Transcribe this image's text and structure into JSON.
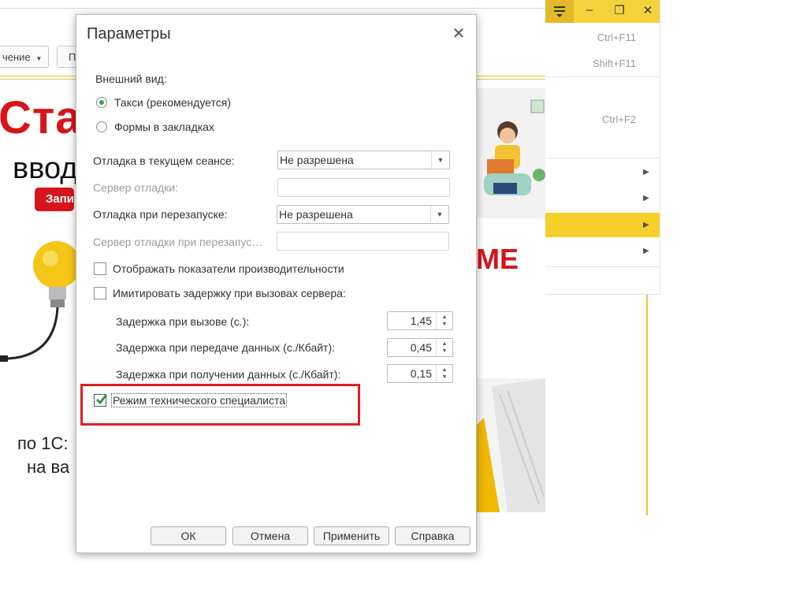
{
  "background": {
    "toolbar_button_1": "чение",
    "toolbar_button_2": "П",
    "banner_red_text": "Стар",
    "banner_black_text": "ввод",
    "banner_button": "Запи",
    "banner2_red_text": "МЕ",
    "bottom_line1": "по 1С:",
    "bottom_line2": "на ва"
  },
  "menu": {
    "shortcuts": [
      "Ctrl+F11",
      "Shift+F11",
      "Ctrl+F2"
    ],
    "submenu_arrow": "▶",
    "highlight_color": "#f7cf2a"
  },
  "dialog": {
    "title": "Параметры",
    "close_icon": "✕",
    "appearance_label": "Внешний вид:",
    "appearance_options": [
      {
        "label": "Такси (рекомендуется)",
        "selected": true
      },
      {
        "label": "Формы в закладках",
        "selected": false
      }
    ],
    "debug_current_label": "Отладка в текущем сеансе:",
    "debug_current_value": "Не разрешена",
    "debug_server_label": "Сервер отладки:",
    "debug_restart_label": "Отладка при перезапуске:",
    "debug_restart_value": "Не разрешена",
    "debug_restart_server_label": "Сервер отладки при перезапус…",
    "show_perf_label": "Отображать показатели производительности",
    "show_perf_checked": false,
    "simulate_delay_label": "Имитировать задержку при вызовах сервера:",
    "simulate_delay_checked": false,
    "delay_call_label": "Задержка при вызове (с.):",
    "delay_call_value": "1,45",
    "delay_send_label": "Задержка при передаче данных (с./Кбайт):",
    "delay_send_value": "0,45",
    "delay_recv_label": "Задержка при получении данных (с./Кбайт):",
    "delay_recv_value": "0,15",
    "tech_mode_label": "Режим технического специалиста",
    "tech_mode_checked": true,
    "buttons": {
      "ok": "ОК",
      "cancel": "Отмена",
      "apply": "Применить",
      "help": "Справка"
    }
  }
}
